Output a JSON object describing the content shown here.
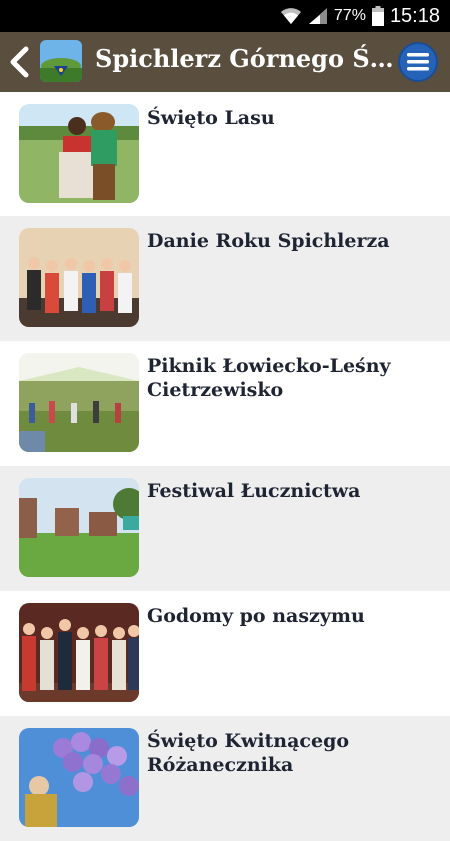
{
  "status": {
    "battery_percent": "77%",
    "time": "15:18"
  },
  "app_bar": {
    "title": "Spichlerz Górnego Śląska",
    "accent_color": "#5a4e3e",
    "menu_color": "#2563b9"
  },
  "events": [
    {
      "title": "Święto Lasu"
    },
    {
      "title": "Danie Roku Spichlerza"
    },
    {
      "title": "Piknik Łowiecko-Leśny Cietrzewisko"
    },
    {
      "title": "Festiwal Łucznictwa"
    },
    {
      "title": "Godomy po naszymu"
    },
    {
      "title": "Święto Kwitnącego Różanecznika"
    }
  ]
}
